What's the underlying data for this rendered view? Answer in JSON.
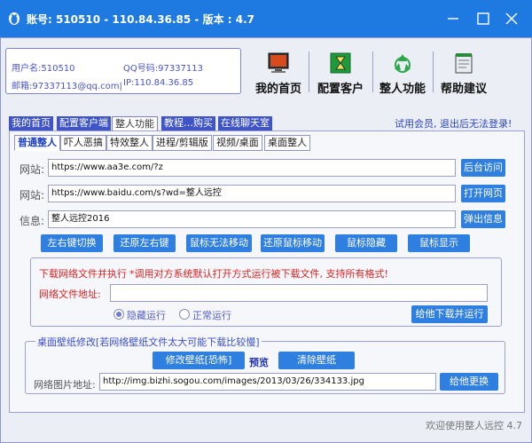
{
  "title_bar": {
    "text": "账号: 510510 - 110.84.36.85 - 版本 : 4.7",
    "min_icon": "minimize-icon",
    "max_icon": "maximize-icon",
    "close_icon": "close-icon"
  },
  "user": {
    "username": "用户名:510510",
    "qq": "QQ号码:97337113",
    "email": "邮箱:97337113@qq.com|",
    "ip": "IP:110.84.36.85"
  },
  "nav": [
    {
      "label": "我的首页",
      "icon": "monitor-icon"
    },
    {
      "label": "配置客户",
      "icon": "hourglass-icon"
    },
    {
      "label": "整人功能",
      "icon": "recycle-icon"
    },
    {
      "label": "帮助建议",
      "icon": "notepad-icon"
    }
  ],
  "main_tabs": [
    "我的首页",
    "配置客户端",
    "整人功能",
    "教程…购买",
    "在线聊天室"
  ],
  "notice": "试用会员, 退出后无法登录!",
  "sub_tabs": [
    "普通整人",
    "吓人恶搞",
    "特效整人",
    "进程/剪辑版",
    "视频/桌面",
    "桌面整人"
  ],
  "form": {
    "site_label": "网站:",
    "site1_value": "https://www.aa3e.com/?z",
    "site1_button": "后台访问",
    "site2_value": "https://www.baidu.com/s?wd=整人远控",
    "site2_button": "打开网页",
    "info_label": "信息:",
    "info_value": "整人远控2016",
    "info_button": "弹出信息"
  },
  "actions": [
    "左右键切换",
    "还原左右键",
    "鼠标无法移动",
    "还原鼠标移动",
    "鼠标隐藏",
    "鼠标显示"
  ],
  "download": {
    "title": "下载网络文件并执行",
    "note": "*调用对方系统默认打开方式运行被下载文件, 支持所有格式!",
    "url_label": "网络文件地址:",
    "url_value": "",
    "opt_hidden": "隐藏运行",
    "opt_normal": "正常运行",
    "button": "给他下载并运行"
  },
  "wallpaper": {
    "legend": "桌面壁纸修改[若网络壁纸文件太大可能下载比较慢]",
    "modify_button": "修改壁纸[恐怖]",
    "preview_link": "预览",
    "clear_button": "清除壁纸",
    "url_label": "网络图片地址:",
    "url_value": "http://img.bizhi.sogou.com/images/2013/03/26/334133.jpg",
    "apply_button": "给他更换"
  },
  "footer": "欢迎使用整人远控 4.7"
}
